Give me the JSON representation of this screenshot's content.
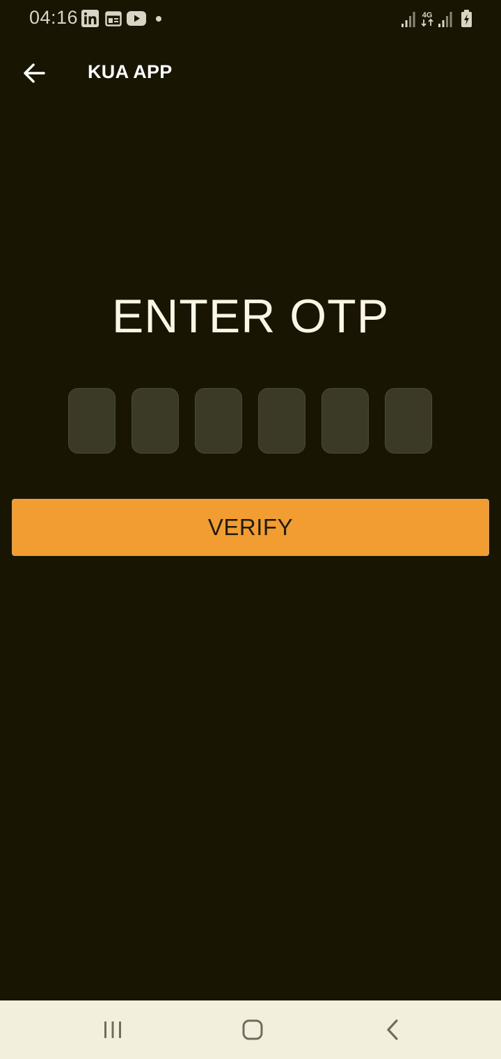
{
  "status_bar": {
    "time": "04:16",
    "notification_icons": [
      "linkedin-icon",
      "calendar-icon",
      "youtube-icon",
      "dot-icon"
    ],
    "right_icons": [
      "signal-icon",
      "4g-icon",
      "signal-icon",
      "battery-charging-icon"
    ],
    "network_label": "4G"
  },
  "app_bar": {
    "title": "KUA APP",
    "back_icon": "arrow-left-icon"
  },
  "otp": {
    "heading": "ENTER OTP",
    "digits": [
      "",
      "",
      "",
      "",
      "",
      ""
    ]
  },
  "verify_button": {
    "label": "VERIFY"
  },
  "nav_bar": {
    "icons": [
      "recent-apps-icon",
      "home-icon",
      "back-icon"
    ]
  },
  "colors": {
    "background": "#181602",
    "accent": "#f19d31",
    "otp_box": "#3b3a26",
    "nav_bar": "#f2efdd",
    "text": "#fbf6e6"
  }
}
